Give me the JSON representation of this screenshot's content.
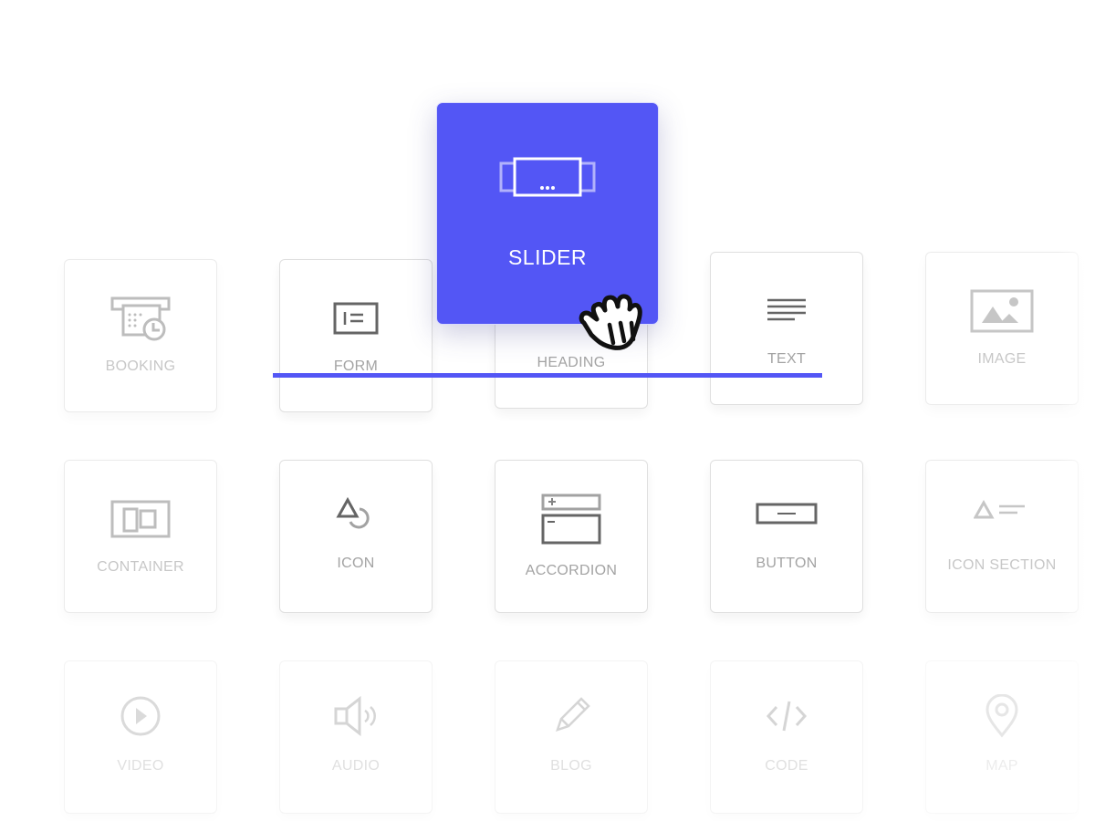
{
  "widgets": {
    "booking": {
      "label": "BOOKING",
      "icon": "booking-calendar-clock-icon"
    },
    "form": {
      "label": "FORM",
      "icon": "form-icon"
    },
    "heading": {
      "label": "HEADING",
      "icon": "heading-icon"
    },
    "text": {
      "label": "TEXT",
      "icon": "text-lines-icon"
    },
    "image": {
      "label": "IMAGE",
      "icon": "image-icon"
    },
    "container": {
      "label": "CONTAINER",
      "icon": "container-columns-icon"
    },
    "icon": {
      "label": "ICON",
      "icon": "shapes-icon"
    },
    "accordion": {
      "label": "ACCORDION",
      "icon": "accordion-icon"
    },
    "button": {
      "label": "BUTTON",
      "icon": "button-icon"
    },
    "icon_section": {
      "label": "ICON SECTION",
      "icon": "icon-section-icon"
    },
    "video": {
      "label": "VIDEO",
      "icon": "play-circle-icon"
    },
    "audio": {
      "label": "AUDIO",
      "icon": "speaker-icon"
    },
    "blog": {
      "label": "BLOG",
      "icon": "pencil-icon"
    },
    "code": {
      "label": "CODE",
      "icon": "code-brackets-icon"
    },
    "map": {
      "label": "MAP",
      "icon": "map-pin-icon"
    }
  },
  "dragging": {
    "label": "SLIDER",
    "icon": "slider-icon",
    "color": "#5356f5"
  },
  "cursor": {
    "type": "grab-hand"
  }
}
